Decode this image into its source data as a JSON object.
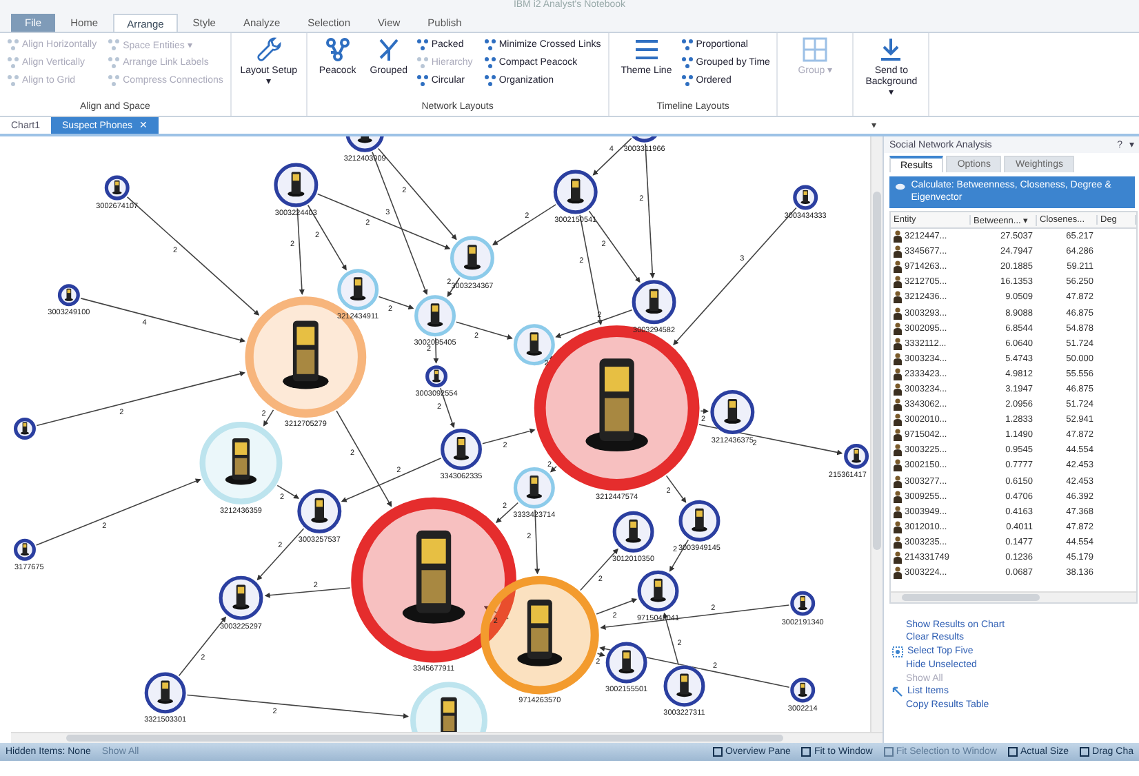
{
  "window": {
    "title": "IBM i2 Analyst's Notebook"
  },
  "ribbon_tabs": [
    {
      "label": "File",
      "selected": false,
      "kind": "file"
    },
    {
      "label": "Home",
      "selected": false,
      "kind": "tab"
    },
    {
      "label": "Arrange",
      "selected": true,
      "kind": "tab"
    },
    {
      "label": "Style",
      "selected": false,
      "kind": "tab"
    },
    {
      "label": "Analyze",
      "selected": false,
      "kind": "tab"
    },
    {
      "label": "Selection",
      "selected": false,
      "kind": "tab"
    },
    {
      "label": "View",
      "selected": false,
      "kind": "tab"
    },
    {
      "label": "Publish",
      "selected": false,
      "kind": "tab"
    }
  ],
  "ribbon_groups": [
    {
      "label": "Align and Space",
      "items": [
        {
          "label": "Align Horizontally",
          "kind": "small",
          "disabled": true
        },
        {
          "label": "Align Vertically",
          "kind": "small",
          "disabled": true
        },
        {
          "label": "Align to Grid",
          "kind": "small",
          "disabled": true
        },
        {
          "label": "Space Entities ▾",
          "kind": "small",
          "disabled": true
        },
        {
          "label": "Arrange Link Labels",
          "kind": "small",
          "disabled": true
        },
        {
          "label": "Compress Connections",
          "kind": "small",
          "disabled": true
        }
      ]
    },
    {
      "items": [
        {
          "label": "Layout Setup ▾",
          "kind": "large",
          "disabled": false
        }
      ]
    },
    {
      "label": "Network Layouts",
      "items": [
        {
          "label": "Peacock",
          "kind": "large",
          "disabled": false
        },
        {
          "label": "Grouped",
          "kind": "large",
          "disabled": false
        },
        {
          "label": "Packed",
          "kind": "small",
          "disabled": false
        },
        {
          "label": "Hierarchy",
          "kind": "small",
          "disabled": true
        },
        {
          "label": "Circular",
          "kind": "small",
          "disabled": false
        },
        {
          "label": "Minimize Crossed Links",
          "kind": "small",
          "disabled": false
        },
        {
          "label": "Compact Peacock",
          "kind": "small",
          "disabled": false
        },
        {
          "label": "Organization",
          "kind": "small",
          "disabled": false
        }
      ]
    },
    {
      "label": "Timeline Layouts",
      "items": [
        {
          "label": "Theme Line",
          "kind": "large",
          "disabled": false
        },
        {
          "label": "Proportional",
          "kind": "small",
          "disabled": false
        },
        {
          "label": "Grouped by Time",
          "kind": "small",
          "disabled": false
        },
        {
          "label": "Ordered",
          "kind": "small",
          "disabled": false
        }
      ]
    },
    {
      "items": [
        {
          "label": "Group ▾",
          "kind": "large",
          "disabled": true
        }
      ]
    },
    {
      "items": [
        {
          "label": "Send to Background ▾",
          "kind": "large",
          "disabled": false
        }
      ]
    }
  ],
  "doc_tabs": [
    {
      "label": "Chart1",
      "selected": false
    },
    {
      "label": "Suspect Phones",
      "selected": true,
      "close": "✕"
    }
  ],
  "doc_menu": "▾",
  "graph": {
    "nodes": [
      {
        "label": "3212403909",
        "kind": "node",
        "color": "#2b3fa0"
      },
      {
        "label": "3003311966",
        "kind": "node",
        "color": "#2b3fa0"
      },
      {
        "label": "3002674107",
        "kind": "node",
        "color": "#2b3fa0"
      },
      {
        "label": "3003224403",
        "kind": "node",
        "color": "#2b3fa0"
      },
      {
        "label": "3002150541",
        "kind": "node",
        "color": "#2b3fa0"
      },
      {
        "label": "3003434333",
        "kind": "node",
        "color": "#2b3fa0"
      },
      {
        "label": "3003249100",
        "kind": "node",
        "color": "#2b3fa0"
      },
      {
        "label": "3212434911",
        "kind": "node",
        "color": "#8ccbea"
      },
      {
        "label": "3003234367",
        "kind": "node",
        "color": "#8ccbea"
      },
      {
        "label": "3002095405",
        "kind": "node",
        "color": "#8ccbea"
      },
      {
        "label": "3003294582",
        "kind": "node",
        "color": "#2b3fa0"
      },
      {
        "kind": "node",
        "color": "#8ccbea"
      },
      {
        "label": "3003092554",
        "kind": "node",
        "color": "#2b3fa0"
      },
      {
        "label": "3212705279",
        "kind": "hub",
        "color": "#f7b57c"
      },
      {
        "label": "3212447574",
        "kind": "hub",
        "color": "#e52d2d"
      },
      {
        "label": "3212436375",
        "kind": "node",
        "color": "#2b3fa0"
      },
      {
        "label": "3212436359",
        "kind": "hub",
        "color": "#bde4ee"
      },
      {
        "kind": "node",
        "color": "#2b3fa0"
      },
      {
        "label": "215361417",
        "kind": "node",
        "color": "#2b3fa0"
      },
      {
        "label": "3343062335",
        "kind": "node",
        "color": "#2b3fa0"
      },
      {
        "label": "3333423714",
        "kind": "node",
        "color": "#8ccbea"
      },
      {
        "label": "3345677911",
        "kind": "hub",
        "color": "#e52d2d"
      },
      {
        "label": "3003257537",
        "kind": "node",
        "color": "#2b3fa0"
      },
      {
        "label": "3012010350",
        "kind": "node",
        "color": "#2b3fa0"
      },
      {
        "label": "3003949145",
        "kind": "node",
        "color": "#2b3fa0"
      },
      {
        "label": "9715042041",
        "kind": "node",
        "color": "#2b3fa0"
      },
      {
        "label": "9714263570",
        "kind": "hub",
        "color": "#f39b2e"
      },
      {
        "label": "3003225297",
        "kind": "node",
        "color": "#2b3fa0"
      },
      {
        "label": "3002155501",
        "kind": "node",
        "color": "#2b3fa0"
      },
      {
        "label": "3002191340",
        "kind": "node",
        "color": "#2b3fa0"
      },
      {
        "label": "3003227311",
        "kind": "node",
        "color": "#2b3fa0"
      },
      {
        "label": "3002214",
        "kind": "node",
        "color": "#2b3fa0"
      },
      {
        "label": "3321503301",
        "kind": "node",
        "color": "#2b3fa0"
      },
      {
        "kind": "hub",
        "color": "#bde4ee"
      },
      {
        "label": "3177675",
        "kind": "node",
        "color": "#2b3fa0"
      }
    ],
    "links": [
      {
        "label": "2"
      },
      {
        "label": "2"
      },
      {
        "label": "2"
      },
      {
        "label": "2"
      },
      {
        "label": "3"
      },
      {
        "label": "2"
      },
      {
        "label": "2"
      },
      {
        "label": "2"
      },
      {
        "label": "4"
      },
      {
        "label": "2"
      },
      {
        "label": "3"
      },
      {
        "label": "2"
      },
      {
        "label": "4"
      },
      {
        "label": "2"
      },
      {
        "label": "2"
      },
      {
        "label": "2"
      },
      {
        "label": "2"
      },
      {
        "label": "2"
      },
      {
        "label": "2"
      },
      {
        "label": "2"
      },
      {
        "label": "2"
      },
      {
        "label": "2"
      },
      {
        "label": "2"
      },
      {
        "label": "2"
      },
      {
        "label": "2"
      },
      {
        "label": "2"
      },
      {
        "label": "2"
      },
      {
        "label": "2"
      },
      {
        "label": "2"
      },
      {
        "label": "2"
      },
      {
        "label": "2"
      },
      {
        "label": "2"
      },
      {
        "label": "2"
      },
      {
        "label": "2"
      },
      {
        "label": "2"
      },
      {
        "label": "2"
      },
      {
        "label": "2"
      },
      {
        "label": "2"
      },
      {
        "label": "2"
      },
      {
        "label": "2"
      },
      {
        "label": "2"
      },
      {
        "label": "2"
      },
      {
        "label": "2"
      },
      {
        "label": "2"
      },
      {
        "label": "2"
      }
    ]
  },
  "panel": {
    "title": "Social Network Analysis",
    "help": "?",
    "menu": "▾",
    "tabs": [
      {
        "label": "Results",
        "selected": true
      },
      {
        "label": "Options",
        "selected": false
      },
      {
        "label": "Weightings",
        "selected": false
      }
    ],
    "calculate": "Calculate: Betweenness, Closeness, Degree & Eigenvector",
    "columns": [
      "Entity",
      "Betweenn... ▾",
      "Closenes...",
      "Deg"
    ],
    "rows": [
      [
        "3212447...",
        "27.5037",
        "65.217"
      ],
      [
        "3345677...",
        "24.7947",
        "64.286"
      ],
      [
        "9714263...",
        "20.1885",
        "59.211"
      ],
      [
        "3212705...",
        "16.1353",
        "56.250"
      ],
      [
        "3212436...",
        "9.0509",
        "47.872"
      ],
      [
        "3003293...",
        "8.9088",
        "46.875"
      ],
      [
        "3002095...",
        "6.8544",
        "54.878"
      ],
      [
        "3332112...",
        "6.0640",
        "51.724"
      ],
      [
        "3003234...",
        "5.4743",
        "50.000"
      ],
      [
        "2333423...",
        "4.9812",
        "55.556"
      ],
      [
        "3003234...",
        "3.1947",
        "46.875"
      ],
      [
        "3343062...",
        "2.0956",
        "51.724"
      ],
      [
        "3002010...",
        "1.2833",
        "52.941"
      ],
      [
        "9715042...",
        "1.1490",
        "47.872"
      ],
      [
        "3003225...",
        "0.9545",
        "44.554"
      ],
      [
        "3002150...",
        "0.7777",
        "42.453"
      ],
      [
        "3003277...",
        "0.6150",
        "42.453"
      ],
      [
        "3009255...",
        "0.4706",
        "46.392"
      ],
      [
        "3003949...",
        "0.4163",
        "47.368"
      ],
      [
        "3012010...",
        "0.4011",
        "47.872"
      ],
      [
        "3003235...",
        "0.1477",
        "44.554"
      ],
      [
        "214331749",
        "0.1236",
        "45.179"
      ],
      [
        "3003224...",
        "0.0687",
        "38.136"
      ]
    ],
    "actions": [
      {
        "label": "Show Results on Chart",
        "disabled": false,
        "kind": "plain"
      },
      {
        "label": "Clear Results",
        "disabled": false,
        "kind": "plain"
      },
      {
        "label": "Select Top Five",
        "disabled": false,
        "kind": "select"
      },
      {
        "label": "Hide Unselected",
        "disabled": false,
        "kind": "plain"
      },
      {
        "label": "Show All",
        "disabled": true,
        "kind": "plain"
      },
      {
        "label": "List Items",
        "disabled": false,
        "kind": "list"
      },
      {
        "label": "Copy Results Table",
        "disabled": false,
        "kind": "plain"
      }
    ]
  },
  "status_bar": {
    "hidden": "Hidden Items: None",
    "show_all": {
      "label": "Show All",
      "disabled": true
    },
    "buttons": [
      {
        "label": "Overview Pane",
        "disabled": false
      },
      {
        "label": "Fit to Window",
        "disabled": false
      },
      {
        "label": "Fit Selection to Window",
        "disabled": true
      },
      {
        "label": "Actual Size",
        "disabled": false
      },
      {
        "label": "Drag Cha",
        "disabled": false
      }
    ]
  }
}
